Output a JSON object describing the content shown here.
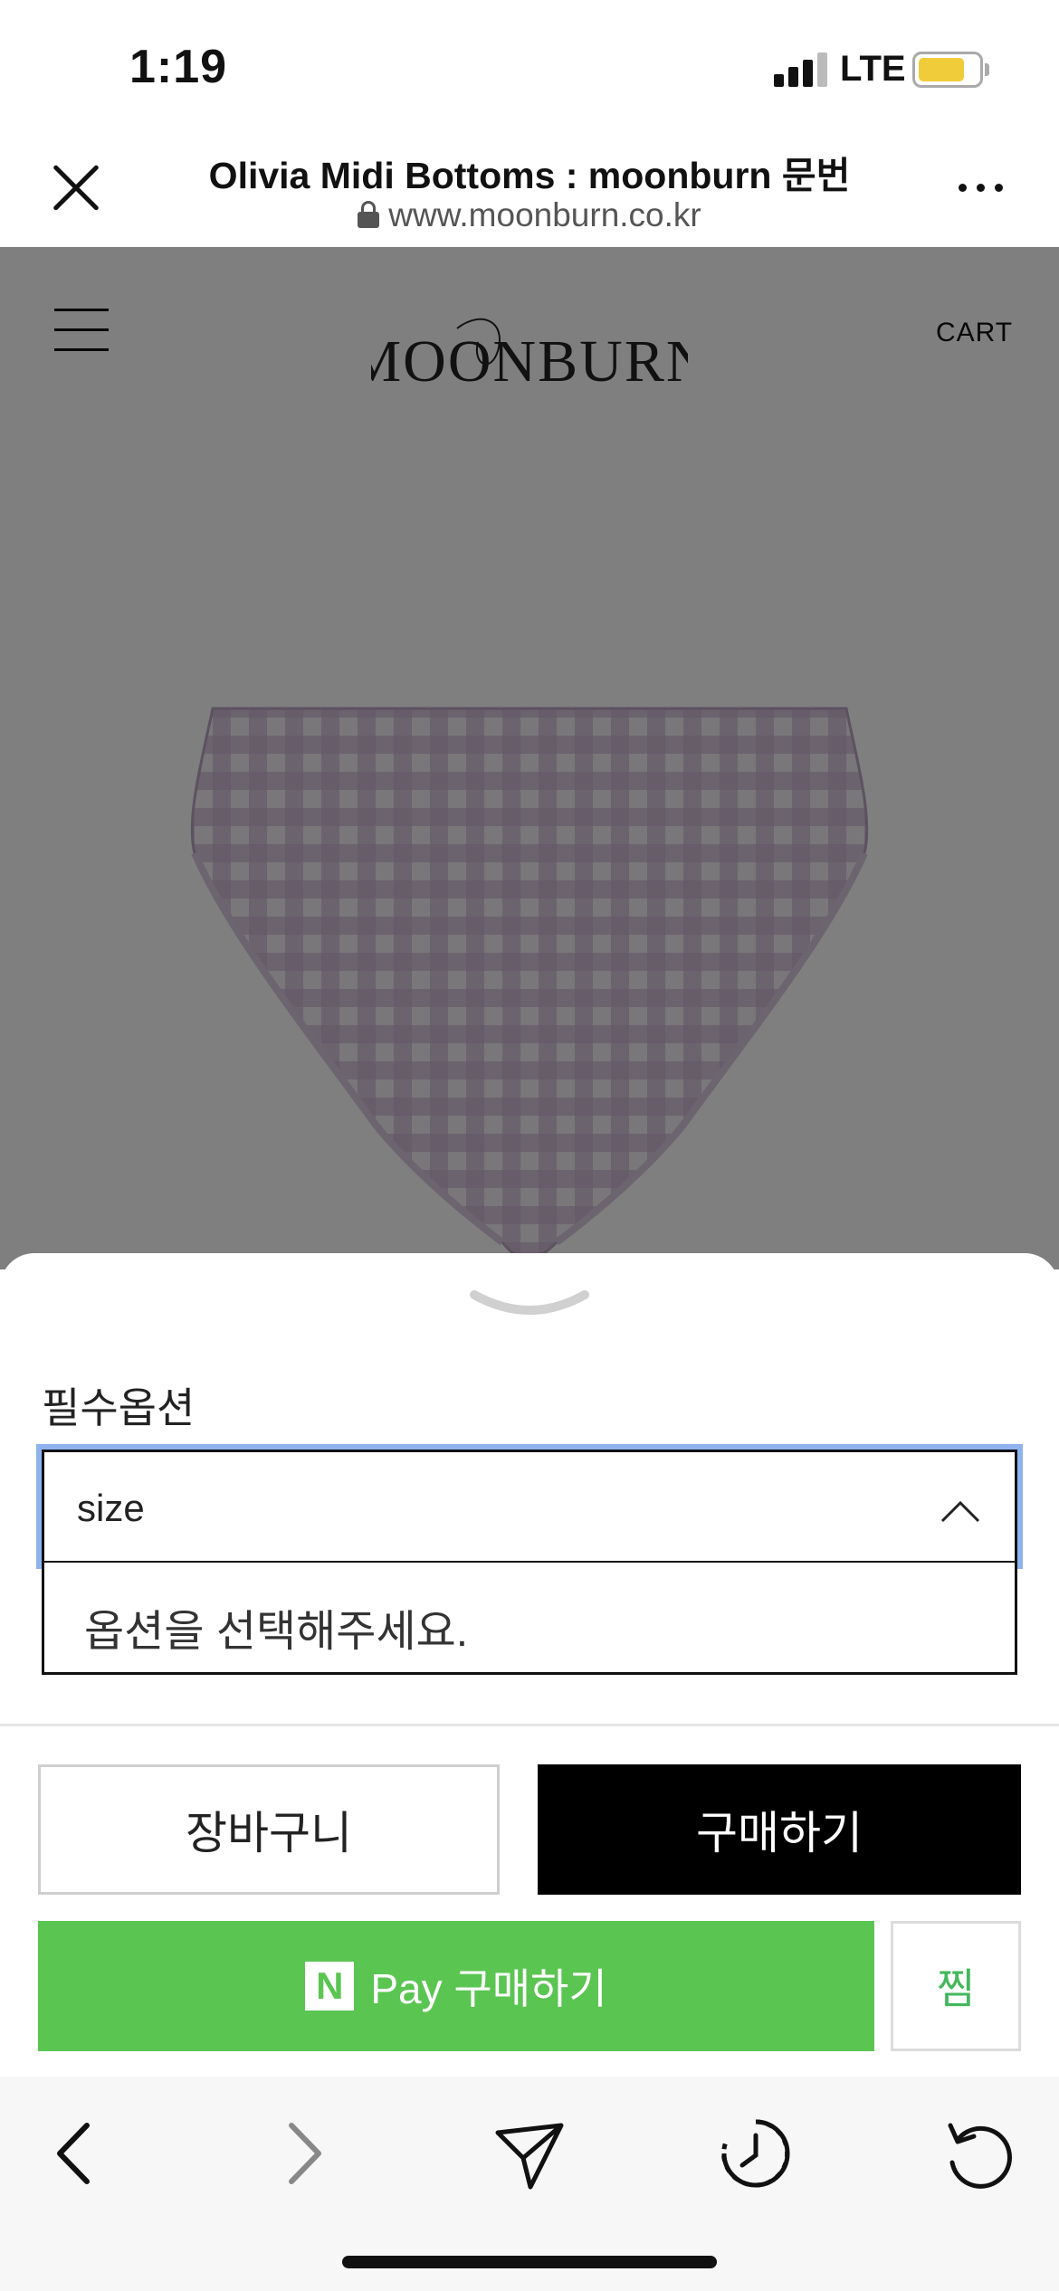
{
  "status_bar": {
    "time": "1:19",
    "network": "LTE",
    "battery_color": "#f1cc3a"
  },
  "browser_header": {
    "title": "Olivia Midi Bottoms : moonburn 문번",
    "url": "www.moonburn.co.kr",
    "close_icon": "close-icon",
    "more_icon": "more-icon"
  },
  "site": {
    "menu_icon": "hamburger-icon",
    "logo_text": "MOONBURN",
    "cart_label": "CART"
  },
  "sheet": {
    "option_label": "필수옵션",
    "select": {
      "value": "size",
      "options": [
        "옵션을 선택해주세요."
      ]
    },
    "buttons": {
      "cart": "장바구니",
      "buy": "구매하기",
      "npay_logo": "N",
      "npay": "Pay 구매하기",
      "wish": "찜"
    },
    "colors": {
      "buy_bg": "#000000",
      "npay_bg": "#5bc552",
      "wish_text": "#43b85c",
      "focus_ring": "#8fb3ee"
    }
  },
  "toolbar": {
    "items": [
      "back-icon",
      "forward-icon",
      "share-icon",
      "history-icon",
      "reload-icon"
    ]
  }
}
